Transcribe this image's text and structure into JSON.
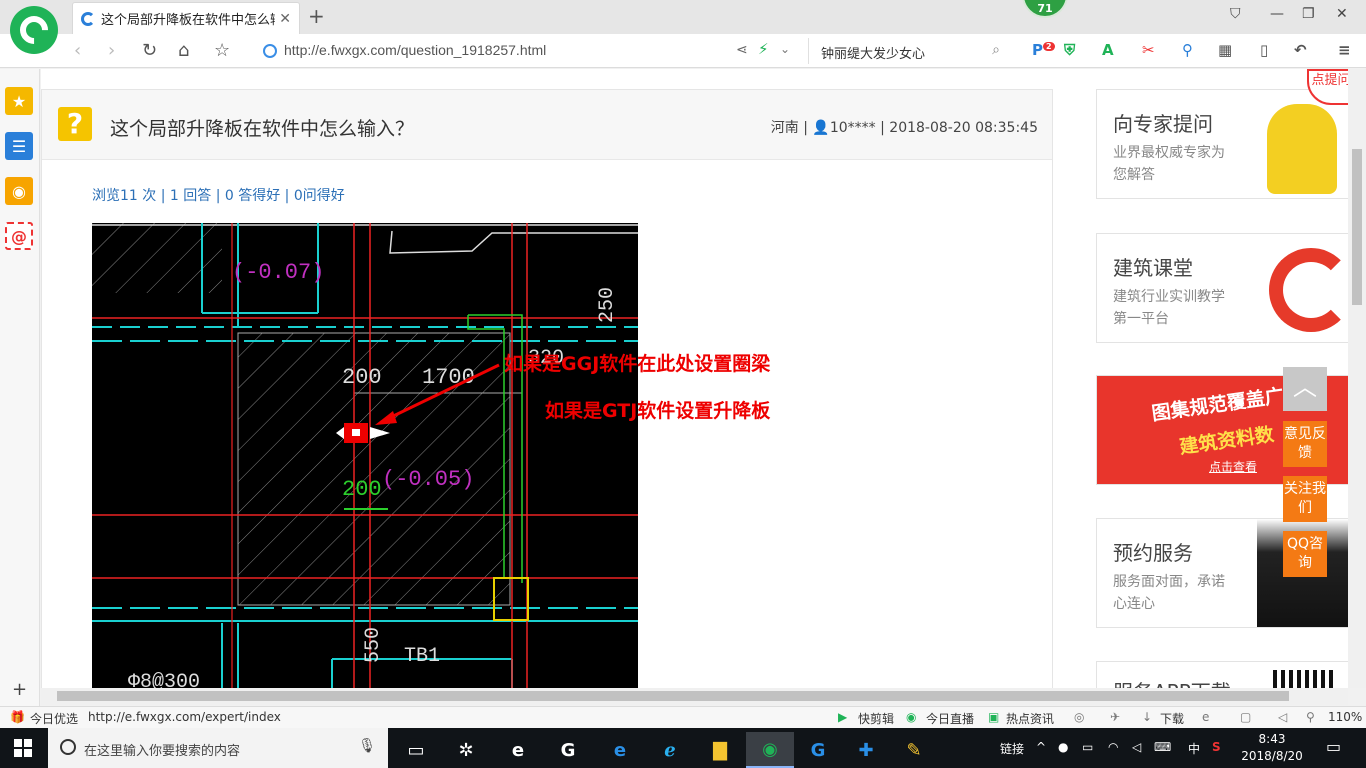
{
  "browser": {
    "tab_title": "这个局部升降板在软件中怎么输入",
    "badge": "71",
    "url": "http://e.fwxgx.com/question_1918257.html",
    "search_text": "钟丽缇大发少女心",
    "ext_badge": "2"
  },
  "question": {
    "title": "这个局部升降板在软件中怎么输入？",
    "region": "河南",
    "user": "10****",
    "datetime": "2018-08-20 08:35:45",
    "stats": "浏览11 次 | 1 回答 | 0 答得好 | 0问得好"
  },
  "cad": {
    "labels": {
      "elev1": "(-0.07)",
      "elev2": "(-0.05)",
      "d200a": "200",
      "d1700": "1700",
      "d320": "320",
      "d250": "250",
      "d200b": "200",
      "d550": "550",
      "tb1": "TB1",
      "rebar": "Φ8@300"
    },
    "annotation1": "如果是GGJ软件在此处设置圈梁",
    "annotation2": "如果是GTJ软件设置升降板"
  },
  "ads": [
    {
      "heading": "向专家提问",
      "sub": "业界最权威专家为您解答"
    },
    {
      "heading": "建筑课堂",
      "sub": "建筑行业实训教学第一平台"
    },
    {
      "heading": "图集规范覆盖广",
      "sub": "建筑资料数",
      "cta": "点击查看"
    },
    {
      "heading": "预约服务",
      "sub": "服务面对面，承诺心连心"
    },
    {
      "heading": "服务APP下载",
      "sub": ""
    }
  ],
  "corner_badge": "点提问",
  "float_buttons": [
    "意见反馈",
    "关注我们",
    "QQ咨询"
  ],
  "statusbar": {
    "today": "今日优选",
    "link": "http://e.fwxgx.com/expert/index",
    "items": [
      "快剪辑",
      "今日直播",
      "热点资讯",
      "下载"
    ],
    "zoom": "110%"
  },
  "taskbar": {
    "search_placeholder": "在这里输入你要搜索的内容",
    "tray_label": "链接",
    "ime": "中",
    "time": "8:43",
    "date": "2018/8/20"
  },
  "colors": {
    "brand_green": "#1fb357",
    "link_blue": "#2b6fb6",
    "accent_orange": "#f47a14",
    "annotation_red": "#e00000"
  }
}
